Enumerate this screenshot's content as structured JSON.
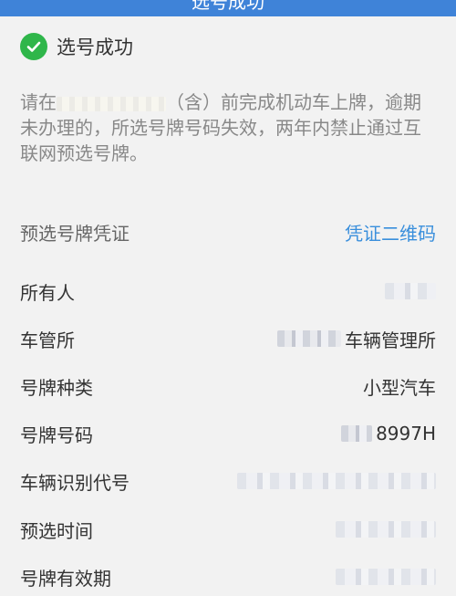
{
  "topbar": {
    "title": "选号成功"
  },
  "status": {
    "label": "选号成功",
    "icon": "check-circle-icon",
    "color": "#2fb64a"
  },
  "notice": {
    "prefix": "请在",
    "middle": "（含）前完成机动车上牌，逾期未办理的",
    "text": "，所选号牌号码失效，两年内禁止通过互联网预选号牌。"
  },
  "certificate": {
    "label": "预选号牌凭证",
    "qr_link": "凭证二维码"
  },
  "fields": {
    "owner": {
      "label": "所有人"
    },
    "office": {
      "label": "车管所",
      "value": "车辆管理所"
    },
    "plate_type": {
      "label": "号牌种类",
      "value": "小型汽车"
    },
    "plate_number": {
      "label": "号牌号码",
      "value": "8997H"
    },
    "vin": {
      "label": "车辆识别代号"
    },
    "select_time": {
      "label": "预选时间"
    },
    "validity": {
      "label": "号牌有效期"
    }
  }
}
